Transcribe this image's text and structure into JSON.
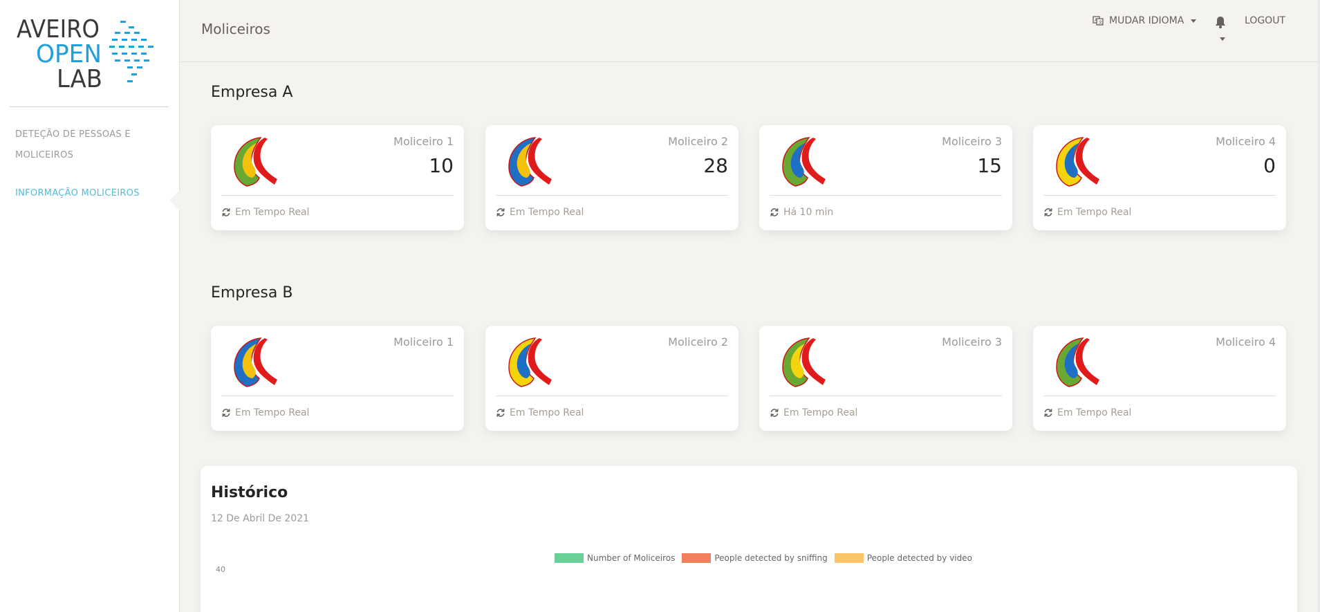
{
  "sidebar": {
    "logo": {
      "line1": "AVEIRO",
      "line2": "OPEN",
      "line3": "LAB"
    },
    "items": [
      {
        "label": "DETEÇÃO DE PESSOAS E MOLICEIROS",
        "active": false
      },
      {
        "label": "INFORMAÇÃO MOLICEIROS",
        "active": true
      }
    ]
  },
  "navbar": {
    "title": "Moliceiros",
    "language_label": "MUDAR IDIOMA",
    "logout_label": "LOGOUT"
  },
  "sections": [
    {
      "title": "Empresa A",
      "cards": [
        {
          "title": "Moliceiro 1",
          "value": "10",
          "footer": "Em Tempo Real",
          "palette": [
            "#69a832",
            "#f4c20d",
            "#e01b1b"
          ]
        },
        {
          "title": "Moliceiro 2",
          "value": "28",
          "footer": "Em Tempo Real",
          "palette": [
            "#1f6fc4",
            "#f4c20d",
            "#e01b1b"
          ]
        },
        {
          "title": "Moliceiro 3",
          "value": "15",
          "footer": "Há 10 min",
          "palette": [
            "#69a832",
            "#1f6fc4",
            "#e01b1b"
          ]
        },
        {
          "title": "Moliceiro 4",
          "value": "0",
          "footer": "Em Tempo Real",
          "palette": [
            "#f4d40d",
            "#1f6fc4",
            "#e01b1b"
          ]
        }
      ]
    },
    {
      "title": "Empresa B",
      "cards": [
        {
          "title": "Moliceiro 1",
          "value": "",
          "footer": "Em Tempo Real",
          "palette": [
            "#1f6fc4",
            "#f4c20d",
            "#e01b1b"
          ]
        },
        {
          "title": "Moliceiro 2",
          "value": "",
          "footer": "Em Tempo Real",
          "palette": [
            "#f4d40d",
            "#1f6fc4",
            "#e01b1b"
          ]
        },
        {
          "title": "Moliceiro 3",
          "value": "",
          "footer": "Em Tempo Real",
          "palette": [
            "#69a832",
            "#f4d40d",
            "#e01b1b"
          ]
        },
        {
          "title": "Moliceiro 4",
          "value": "",
          "footer": "Em Tempo Real",
          "palette": [
            "#69a832",
            "#1f6fc4",
            "#e01b1b"
          ]
        }
      ]
    }
  ],
  "history": {
    "title": "Histórico",
    "date": "12 De Abril De 2021",
    "legend": [
      {
        "label": "Number of Moliceiros",
        "color": "#6bd098"
      },
      {
        "label": "People detected by sniffing",
        "color": "#f17e5d"
      },
      {
        "label": "People detected by video",
        "color": "#fcc468"
      }
    ],
    "y_tick_top": "40"
  },
  "colors": {
    "accent": "#51bcda",
    "background": "#f4f3ef"
  }
}
